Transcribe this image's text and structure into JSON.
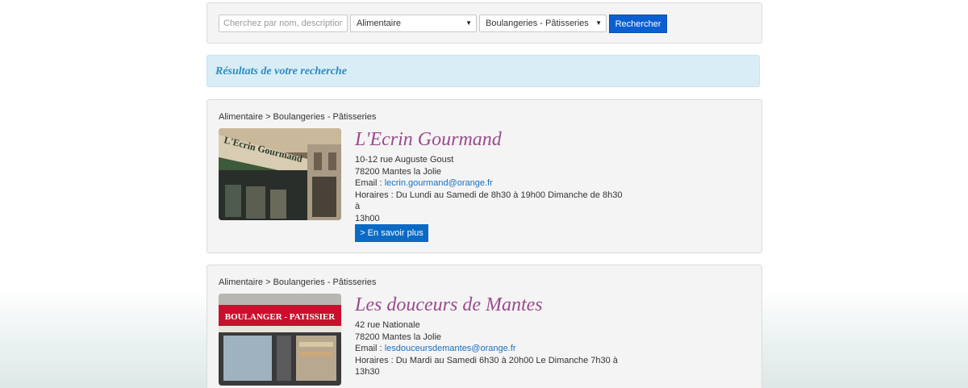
{
  "search": {
    "placeholder": "Cherchez par nom, description ...",
    "category_selected": "Alimentaire",
    "subcategory_selected": "Boulangeries - Pâtisseries",
    "button_label": "Rechercher"
  },
  "results": {
    "title": "Résultats de votre recherche",
    "items": [
      {
        "breadcrumb": "Alimentaire > Boulangeries - Pâtisseries",
        "name": "L'Ecrin Gourmand",
        "address": "10-12 rue Auguste Goust",
        "city": "78200  Mantes la Jolie",
        "email_label": "Email : ",
        "email": "lecrin.gourmand@orange.fr",
        "hours_line1": "Horaires : Du Lundi au Samedi de 8h30 à 19h00 Dimanche de 8h30 à",
        "hours_line2": "13h00",
        "more_label": "> En savoir plus",
        "photo_sign": "L'Ecrin Gourmand"
      },
      {
        "breadcrumb": "Alimentaire > Boulangeries - Pâtisseries",
        "name": "Les douceurs de Mantes",
        "address": "42 rue Nationale",
        "city": "78200  Mantes la Jolie",
        "email_label": "Email : ",
        "email": "lesdouceursdemantes@orange.fr",
        "hours_line1": "Horaires : Du Mardi au Samedi  6h30 à 20h00 Le Dimanche  7h30 à",
        "hours_line2": "13h30",
        "photo_sign": "BOULANGER - PATISSIER"
      }
    ]
  },
  "colors": {
    "accent_blue": "#0b5fd1",
    "shop_name": "#9b4a8c",
    "link": "#1a6fc2",
    "results_header_bg": "#d9edf7"
  },
  "icons": {
    "caret": "chevron-down-icon"
  }
}
